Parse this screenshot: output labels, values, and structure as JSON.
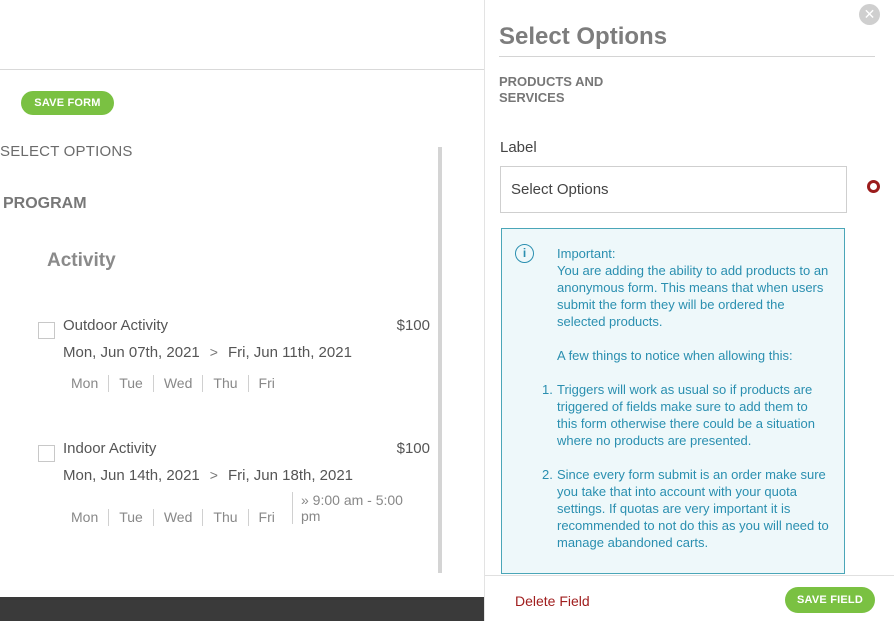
{
  "toolbar": {
    "save_form_label": "SAVE FORM"
  },
  "form": {
    "section_title": "SELECT OPTIONS",
    "program_title": "PROGRAM",
    "activity_title": "Activity",
    "activities": [
      {
        "name": "Outdoor Activity",
        "price": "$100",
        "start_date": "Mon, Jun 07th, 2021",
        "arrow": ">",
        "end_date": "Fri, Jun 11th, 2021",
        "days": [
          "Mon",
          "Tue",
          "Wed",
          "Thu",
          "Fri"
        ],
        "checked": false
      },
      {
        "name": "Indoor Activity",
        "price": "$100",
        "start_date": "Mon, Jun 14th, 2021",
        "arrow": ">",
        "end_date": "Fri, Jun 18th, 2021",
        "days": [
          "Mon",
          "Tue",
          "Wed",
          "Thu",
          "Fri"
        ],
        "time": "» 9:00 am - 5:00 pm",
        "checked": false
      }
    ]
  },
  "panel": {
    "close_symbol": "✕",
    "title": "Select Options",
    "category": "PRODUCTS AND SERVICES",
    "label_caption": "Label",
    "label_value": "Select Options",
    "info": {
      "icon": "i",
      "heading": "Important:",
      "intro": "You are adding the ability to add products to an anonymous form. This means that when users submit the form they will be ordered the selected products.",
      "notice": "A few things to notice when allowing this:",
      "items": [
        {
          "num": "1.",
          "text": "Triggers will work as usual so if products are triggered of fields make sure to add them to this form otherwise there could be a situation where no products are presented."
        },
        {
          "num": "2.",
          "text": "Since every form submit is an order make sure you take that into account with your quota settings. If quotas are very important it is recommended to not do this as you will need to manage abandoned carts."
        }
      ]
    },
    "delete_label": "Delete Field",
    "save_label": "SAVE FIELD"
  },
  "colors": {
    "accent_green": "#7ac142",
    "info_blue": "#2a8fb0",
    "info_bg": "#eef8fa",
    "danger_red": "#a01e1e"
  }
}
